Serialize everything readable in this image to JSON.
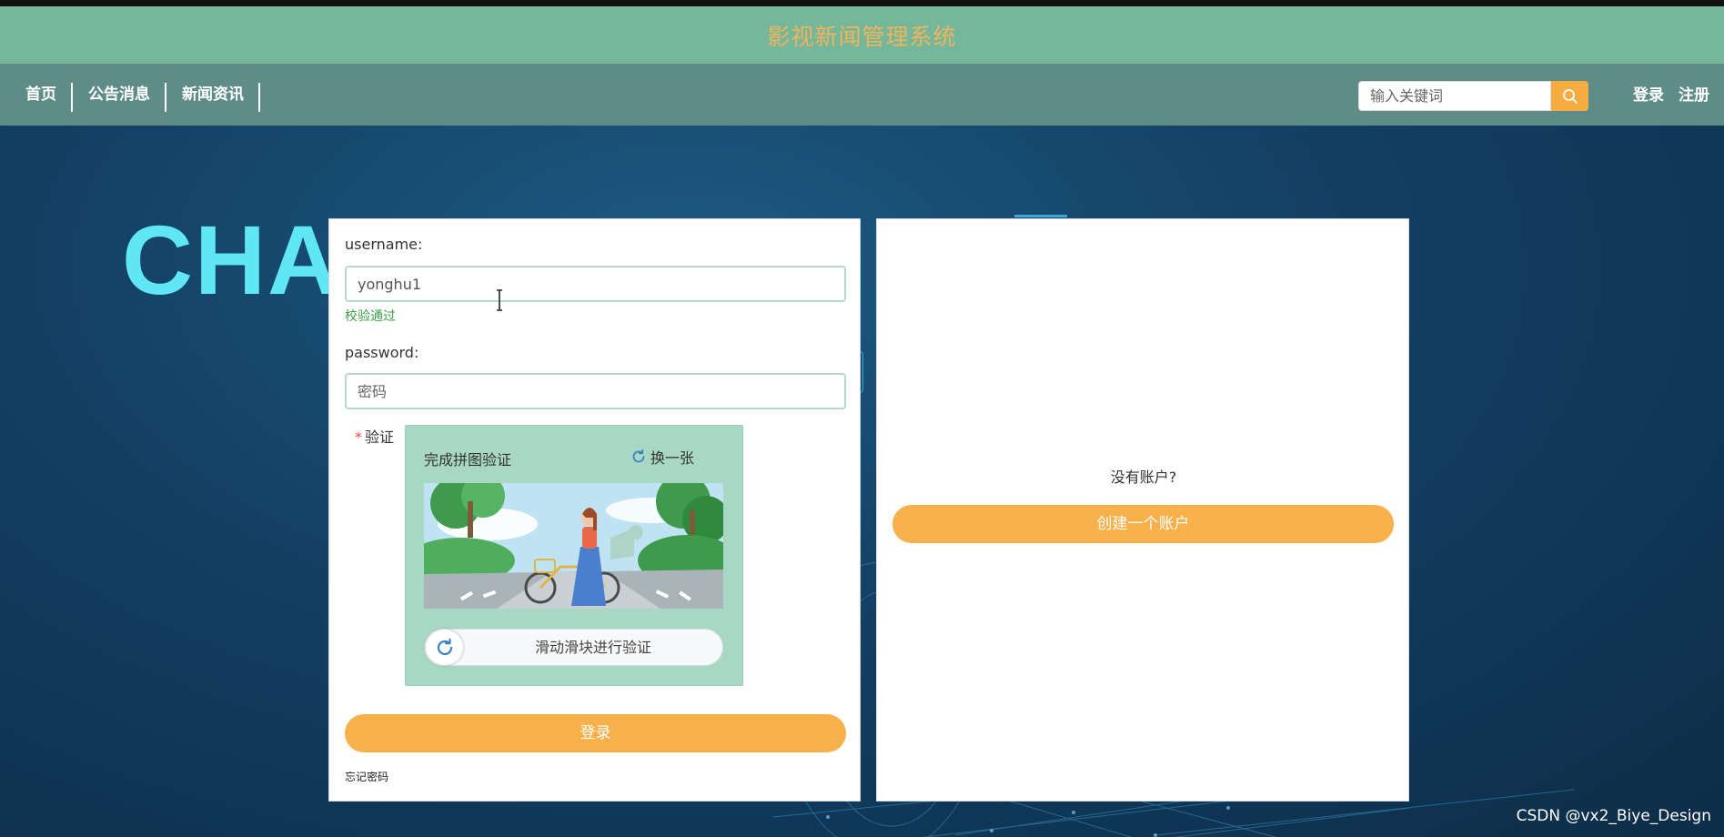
{
  "header": {
    "title": "影视新闻管理系统"
  },
  "nav": {
    "items": [
      {
        "label": "首页"
      },
      {
        "label": "公告消息"
      },
      {
        "label": "新闻资讯"
      }
    ],
    "search_placeholder": "输入关键词",
    "login_label": "登录",
    "register_label": "注册"
  },
  "hero": {
    "text": "CHA"
  },
  "login_form": {
    "username_label": "username:",
    "username_value": "yonghu1",
    "username_status": "校验通过",
    "password_label": "password:",
    "password_placeholder": "密码",
    "verify_label": "验证",
    "verify_required_mark": "*",
    "captcha": {
      "title": "完成拼图验证",
      "refresh_label": "换一张",
      "slider_text": "滑动滑块进行验证"
    },
    "submit_label": "登录",
    "forgot_label": "忘记密码"
  },
  "register_panel": {
    "prompt": "没有账户?",
    "create_label": "创建一个账户"
  },
  "watermark": "CSDN @vx2_Biye_Design",
  "colors": {
    "title_bar": "#75b79b",
    "title_text": "#f2b45a",
    "nav_bar": "#5f8c87",
    "accent_orange": "#f8b04a",
    "captcha_bg": "#a8d8c4",
    "hero_text": "#5fe7f5",
    "success_green": "#3da04a"
  },
  "icons": {
    "search": "search-icon",
    "refresh": "refresh-icon",
    "slider": "refresh-icon",
    "cursor": "text-cursor-icon"
  }
}
